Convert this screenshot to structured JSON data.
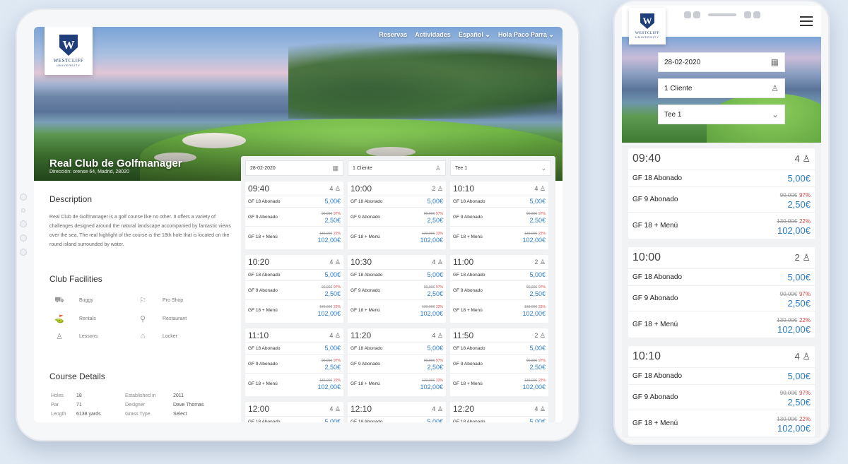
{
  "brand": {
    "name": "WESTCLIFF",
    "sub": "UNIVERSITY",
    "mark": "W"
  },
  "nav": {
    "reservas": "Reservas",
    "actividades": "Actividades",
    "language": "Español",
    "user": "Hola Paco Parra"
  },
  "club": {
    "name": "Real Club de Golfmanager",
    "address": "Dirección: orense 64, Madrid, 28020"
  },
  "description": {
    "title": "Description",
    "text": "Real Club de Golfmanager is a golf course like no other. It offers a variety of challenges designed around the natural landscape accompanied by fantastic views over the sea. The real highlight of the course is the 18th hole that is located on the round island surrounded by water."
  },
  "facilities": {
    "title": "Club Facilities",
    "items": [
      "Buggy",
      "Pro Shop",
      "Rentals",
      "Restaurant",
      "Lessons",
      "Locker"
    ]
  },
  "course": {
    "title": "Course Details",
    "rows": [
      {
        "k1": "Holes",
        "v1": "18",
        "k2": "Established in",
        "v2": "2011"
      },
      {
        "k1": "Par",
        "v1": "71",
        "k2": "Designer",
        "v2": "Dave Thomas"
      },
      {
        "k1": "Length",
        "v1": "6138 yards",
        "k2": "Grass Type",
        "v2": "Select"
      }
    ]
  },
  "filters": {
    "date": "28-02-2020",
    "clients": "1 Cliente",
    "tee": "Tee 1"
  },
  "products": {
    "p1": {
      "name": "GF 18 Abonado",
      "price": "5,00€"
    },
    "p2": {
      "name": "GF 9 Abonado",
      "old": "90,00€",
      "pct": "97%",
      "price": "2,50€"
    },
    "p3": {
      "name": "GF 18 + Menú",
      "old": "130,00€",
      "pct": "22%",
      "price": "102,00€"
    }
  },
  "slots": [
    {
      "time": "09:40",
      "count": "4"
    },
    {
      "time": "10:00",
      "count": "2"
    },
    {
      "time": "10:10",
      "count": "4"
    },
    {
      "time": "10:20",
      "count": "4"
    },
    {
      "time": "10:30",
      "count": "4"
    },
    {
      "time": "11:00",
      "count": "2"
    },
    {
      "time": "11:10",
      "count": "4"
    },
    {
      "time": "11:20",
      "count": "4"
    },
    {
      "time": "11:50",
      "count": "2"
    },
    {
      "time": "12:00",
      "count": "4"
    },
    {
      "time": "12:10",
      "count": "4"
    },
    {
      "time": "12:20",
      "count": "4"
    }
  ]
}
